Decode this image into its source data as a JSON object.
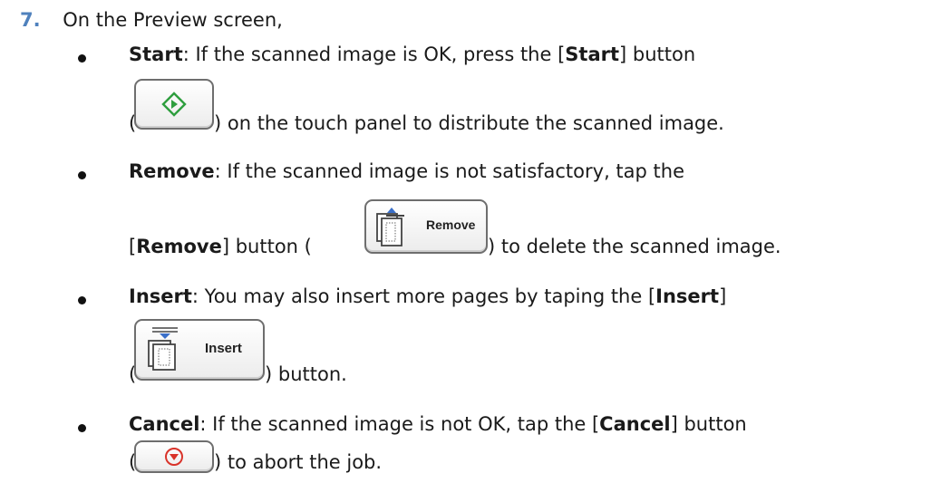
{
  "step": {
    "number": "7.",
    "intro": "On the Preview screen,"
  },
  "items": [
    {
      "term": "Start",
      "line1": ": If the scanned image is OK, press the [",
      "term2": "Start",
      "line1_end": "] button",
      "line2_open": "(",
      "line2_close": ") on the touch panel to distribute the scanned image.",
      "icon": "start-diamond-icon",
      "icon_color": "#2e9e3e"
    },
    {
      "term": "Remove",
      "line1": ": If the scanned image is not satisfactory, tap the",
      "line2_open": "[",
      "term2": "Remove",
      "line2_mid": "] button (",
      "line2_close": ") to delete the scanned image.",
      "button_label": "Remove",
      "icon": "remove-pages-icon"
    },
    {
      "term": "Insert",
      "line1": ": You may also insert more pages by taping the [",
      "term2": "Insert",
      "line1_end": "]",
      "line2_open": "(",
      "line2_close": ") button.",
      "button_label": "Insert",
      "icon": "insert-pages-icon"
    },
    {
      "term": "Cancel",
      "line1": ": If the scanned image is not OK, tap the [",
      "term2": "Cancel",
      "line1_end": "] button",
      "line2_open": "(",
      "line2_close": ") to abort the job.",
      "icon": "cancel-stop-icon",
      "icon_color": "#d9332a"
    }
  ]
}
